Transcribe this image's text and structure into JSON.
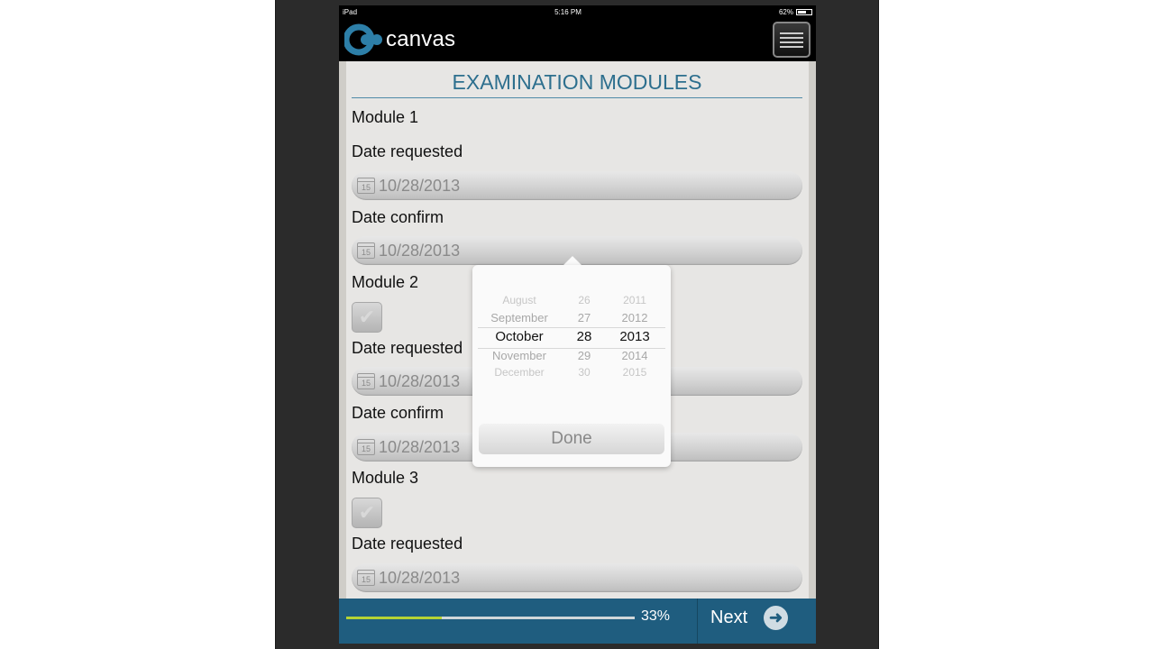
{
  "status_bar": {
    "device": "iPad",
    "time": "5:16 PM",
    "battery": "62%",
    "battery_level": 0.62
  },
  "app": {
    "logo_text": "canvas"
  },
  "page": {
    "title": "EXAMINATION MODULES"
  },
  "modules": [
    {
      "title": "Module 1",
      "has_checkbox": false,
      "fields": [
        {
          "label": "Date requested",
          "value": "10/28/2013"
        },
        {
          "label": "Date confirm",
          "value": "10/28/2013"
        }
      ]
    },
    {
      "title": "Module 2",
      "has_checkbox": true,
      "fields": [
        {
          "label": "Date requested",
          "value": "10/28/2013"
        },
        {
          "label": "Date confirm",
          "value": "10/28/2013"
        }
      ]
    },
    {
      "title": "Module 3",
      "has_checkbox": true,
      "fields": [
        {
          "label": "Date requested",
          "value": "10/28/2013"
        }
      ]
    }
  ],
  "calendar_icon_text": "15",
  "date_picker": {
    "months": [
      "August",
      "September",
      "October",
      "November",
      "December"
    ],
    "days": [
      "26",
      "27",
      "28",
      "29",
      "30"
    ],
    "years": [
      "2011",
      "2012",
      "2013",
      "2014",
      "2015"
    ],
    "selected": {
      "month": "October",
      "day": "28",
      "year": "2013"
    },
    "done_label": "Done"
  },
  "footer": {
    "progress": 0.33,
    "progress_label": "33%",
    "next_label": "Next"
  },
  "colors": {
    "accent": "#2d6f8e",
    "footer_bg": "#1f5d7f",
    "progress_fill": "#b5d334"
  },
  "icons": {
    "menu": "hamburger-menu-icon",
    "next": "arrow-right-circle-icon",
    "calendar": "calendar-icon",
    "check": "checkmark-icon"
  }
}
